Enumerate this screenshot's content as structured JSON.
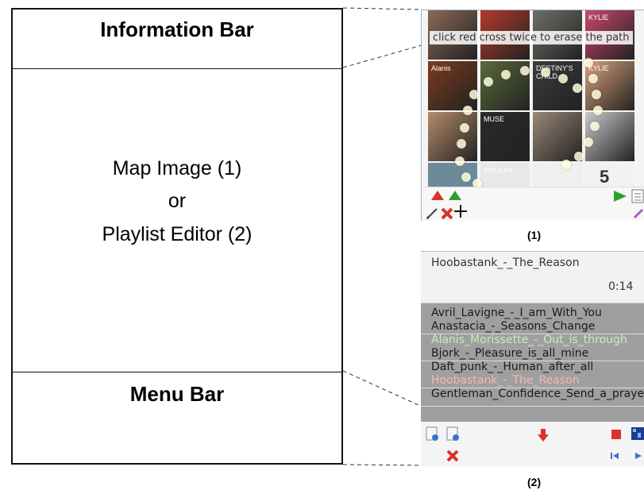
{
  "schematic": {
    "info_title": "Information Bar",
    "main_line1": "Map Image (1)",
    "main_line2": "or",
    "main_line3": "Playlist Editor (2)",
    "menu_title": "Menu Bar"
  },
  "panel1": {
    "info_text": "click red cross twice to erase the path",
    "caption": "(1)",
    "tiles": [
      {
        "color": "#8a6a55",
        "label": ""
      },
      {
        "color": "#b33a2a",
        "label": ""
      },
      {
        "color": "#6f6f68",
        "label": ""
      },
      {
        "color": "#c9466b",
        "label": "KYLIE"
      },
      {
        "color": "#7a3b1e",
        "label": "Alanis"
      },
      {
        "color": "#5a6a3a",
        "label": ""
      },
      {
        "color": "#3b3b3b",
        "label": "DESTINY'S CHILD"
      },
      {
        "color": "#d8a27a",
        "label": "KYLIE"
      },
      {
        "color": "#b58c6a",
        "label": ""
      },
      {
        "color": "#2a2a2a",
        "label": "MUSE"
      },
      {
        "color": "#9a8877",
        "label": ""
      },
      {
        "color": "#c8c8c8",
        "label": ""
      },
      {
        "color": "#6c8a9a",
        "label": ""
      },
      {
        "color": "#e8e8e8",
        "label": "daft punk"
      },
      {
        "color": "#efefef",
        "label": ""
      },
      {
        "color": "#f2f2f2",
        "label": ""
      }
    ],
    "toolbar": {
      "page_number": "5",
      "pencil_icon": "pencil-icon",
      "erase_icon": "red-cross-icon",
      "add_icon": "plus-icon",
      "play_icon": "play-icon",
      "list_icon": "list-icon"
    }
  },
  "panel2": {
    "caption": "(2)",
    "now_playing_title": "Hoobastank_-_The_Reason",
    "now_playing_time": "0:14",
    "items": [
      {
        "label": "Avril_Lavigne_-_I_am_With_You",
        "color": "#1a1a1a"
      },
      {
        "label": "Anastacia_-_Seasons_Change",
        "color": "#1a1a1a"
      },
      {
        "label": "Alanis_Morissette_-_Out_is_through",
        "color": "#c6f0b8"
      },
      {
        "label": "Bjork_-_Pleasure_is_all_mine",
        "color": "#1a1a1a"
      },
      {
        "label": "Daft_punk_-_Human_after_all",
        "color": "#1a1a1a"
      },
      {
        "label": "Hoobastank_-_The_Reason",
        "color": "#f4b7b7"
      },
      {
        "label": "Gentleman_Confidence_Send_a_prayer",
        "color": "#1a1a1a"
      }
    ]
  },
  "colors": {
    "accent_red": "#d9312b",
    "accent_green": "#2ca02c",
    "playlist_bg": "#9f9f9f"
  }
}
